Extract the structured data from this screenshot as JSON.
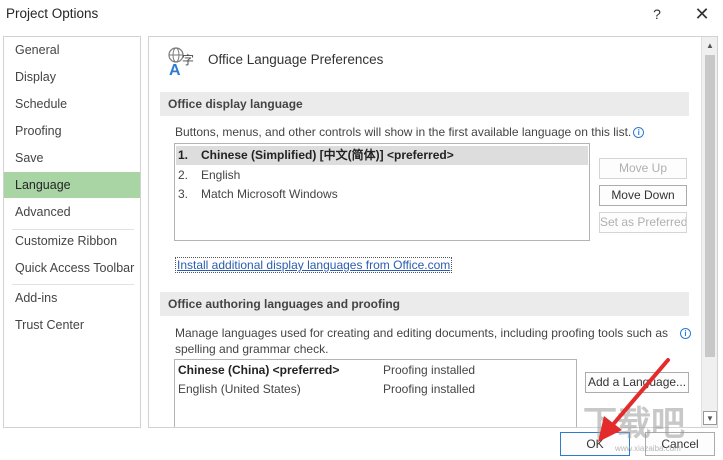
{
  "window": {
    "title": "Project Options",
    "help_glyph": "?",
    "close_glyph": "✕"
  },
  "nav": {
    "items": [
      "General",
      "Display",
      "Schedule",
      "Proofing",
      "Save",
      "Language",
      "Advanced",
      "Customize Ribbon",
      "Quick Access Toolbar",
      "Add-ins",
      "Trust Center"
    ],
    "active": "Language"
  },
  "panel": {
    "header_title": "Office Language Preferences",
    "display_section": {
      "heading": "Office display language",
      "description": "Buttons, menus, and other controls will show in the first available language on this list.",
      "languages": [
        {
          "num": "1.",
          "label": "Chinese (Simplified) [中文(简体)] <preferred>"
        },
        {
          "num": "2.",
          "label": "English"
        },
        {
          "num": "3.",
          "label": "Match Microsoft Windows"
        }
      ],
      "buttons": {
        "move_up": "Move Up",
        "move_down": "Move Down",
        "set_preferred": "Set as Preferred"
      },
      "install_link": "Install additional display languages from Office.com"
    },
    "authoring_section": {
      "heading": "Office authoring languages and proofing",
      "description_line1": "Manage languages used for creating and editing documents, including proofing tools such as",
      "description_line2": "spelling and grammar check.",
      "languages": [
        {
          "name": "Chinese (China) <preferred>",
          "status": "Proofing installed"
        },
        {
          "name": "English (United States)",
          "status": "Proofing installed"
        }
      ],
      "add_button": "Add a Language..."
    }
  },
  "footer": {
    "ok": "OK",
    "cancel": "Cancel"
  },
  "watermark": {
    "text": "下载吧",
    "url": "www.xiazaiba.com"
  },
  "colors": {
    "active_nav": "#a9d4a4",
    "accent": "#2b7cd3",
    "arrow": "#e32b2b"
  }
}
